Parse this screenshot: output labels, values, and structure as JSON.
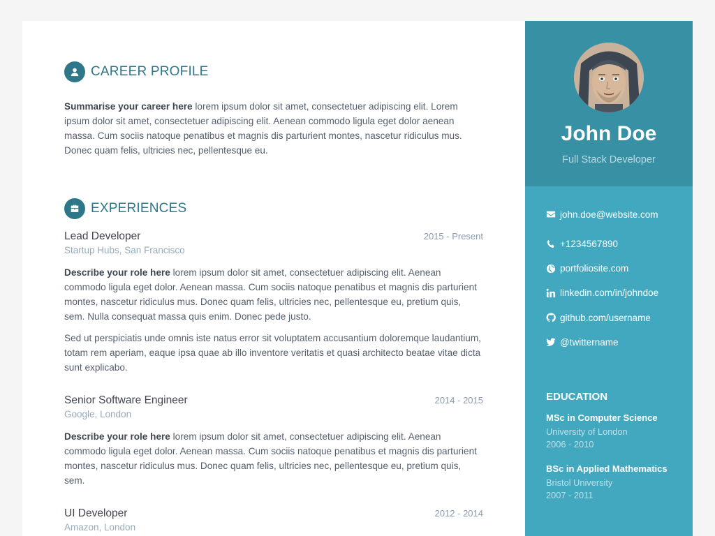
{
  "career": {
    "title": "CAREER PROFILE",
    "lead": "Summarise your career here",
    "text": " lorem ipsum dolor sit amet, consectetuer adipiscing elit. Lorem ipsum dolor sit amet, consectetuer adipiscing elit. Aenean commodo ligula eget dolor aenean massa. Cum sociis natoque penatibus et magnis dis parturient montes, nascetur ridiculus mus. Donec quam felis, ultricies nec, pellentesque eu."
  },
  "experiences": {
    "title": "EXPERIENCES",
    "jobs": [
      {
        "title": "Lead Developer",
        "time": "2015 - Present",
        "company": "Startup Hubs, San Francisco",
        "lead": "Describe your role here",
        "text": " lorem ipsum dolor sit amet, consectetuer adipiscing elit. Aenean commodo ligula eget dolor. Aenean massa. Cum sociis natoque penatibus et magnis dis parturient montes, nascetur ridiculus mus. Donec quam felis, ultricies nec, pellentesque eu, pretium quis, sem. Nulla consequat massa quis enim. Donec pede justo.",
        "text2": "Sed ut perspiciatis unde omnis iste natus error sit voluptatem accusantium doloremque laudantium, totam rem aperiam, eaque ipsa quae ab illo inventore veritatis et quasi architecto beatae vitae dicta sunt explicabo."
      },
      {
        "title": "Senior Software Engineer",
        "time": "2014 - 2015",
        "company": "Google, London",
        "lead": "Describe your role here",
        "text": " lorem ipsum dolor sit amet, consectetuer adipiscing elit. Aenean commodo ligula eget dolor. Aenean massa. Cum sociis natoque penatibus et magnis dis parturient montes, nascetur ridiculus mus. Donec quam felis, ultricies nec, pellentesque eu, pretium quis, sem."
      },
      {
        "title": "UI Developer",
        "time": "2012 - 2014",
        "company": "Amazon, London"
      }
    ]
  },
  "profile": {
    "name": "John Doe",
    "tagline": "Full Stack Developer"
  },
  "contact": {
    "email": "john.doe@website.com",
    "phone": "+1234567890",
    "website": "portfoliosite.com",
    "linkedin": "linkedin.com/in/johndoe",
    "github": "github.com/username",
    "twitter": "@twittername"
  },
  "education": {
    "title": "EDUCATION",
    "items": [
      {
        "degree": "MSc in Computer Science",
        "school": "University of London",
        "years": "2006 - 2010"
      },
      {
        "degree": "BSc in Applied Mathematics",
        "school": "Bristol University",
        "years": "2007 - 2011"
      }
    ]
  },
  "colors": {
    "accent": "#2d7788",
    "sidebar": "#42a8c0",
    "profile_bg": "#3890a5"
  },
  "icons": {
    "career": "user-icon",
    "experiences": "briefcase-icon",
    "email": "envelope-icon",
    "phone": "phone-icon",
    "website": "globe-icon",
    "linkedin": "linkedin-icon",
    "github": "github-icon",
    "twitter": "twitter-icon"
  }
}
